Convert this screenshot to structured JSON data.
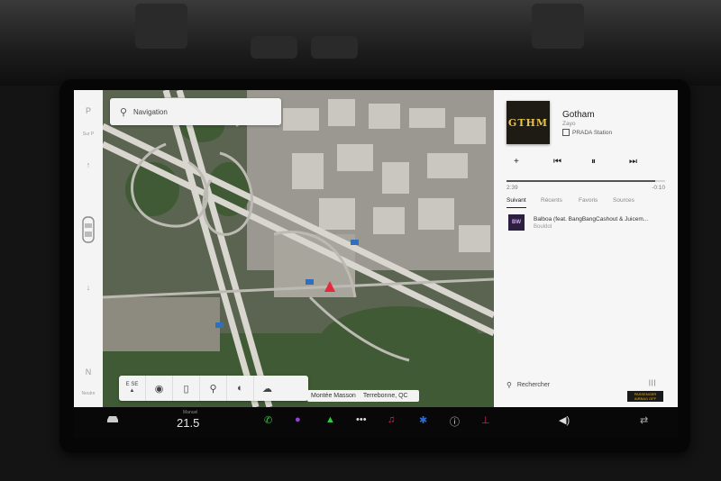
{
  "gear_rail": {
    "top": "P",
    "top_sub": "Sur P",
    "up_arrow": "↑",
    "down_arrow": "↓",
    "bottom": "N",
    "bottom_sub": "Neutre"
  },
  "map": {
    "search_placeholder": "Navigation",
    "compass_text": "E SE",
    "address_street": "Montée Masson",
    "address_city": "Terrebonne, QC",
    "tools": [
      "compass-icon",
      "globe-icon",
      "traffic-icon",
      "pin-icon",
      "satellite-icon",
      "weather-icon"
    ]
  },
  "media": {
    "album_text": "GTHM",
    "track_title": "Gotham",
    "track_artist": "Zayo",
    "track_source": "PRADA Station",
    "elapsed": "2:39",
    "remaining": "-0:10",
    "progress": 0.94,
    "tabs": [
      "Suivant",
      "Récents",
      "Favoris",
      "Sources"
    ],
    "active_tab": "Suivant",
    "queue": [
      {
        "title": "Balboa (feat. BangBangCashout & Juicem...",
        "artist": "Bouldot",
        "art_text": "BW"
      }
    ],
    "search_label": "Rechercher",
    "menu_icon": "|||",
    "airbag_line1": "PASSENGER",
    "airbag_line2": "AIRBAG OFF"
  },
  "dock": {
    "temp_label": "Manuel",
    "temp_value": "21.5",
    "accent_green": "#2ecc40",
    "accent_purple": "#9b3dd6",
    "accent_pink": "#e5285a",
    "accent_blue": "#2e6bdb"
  }
}
